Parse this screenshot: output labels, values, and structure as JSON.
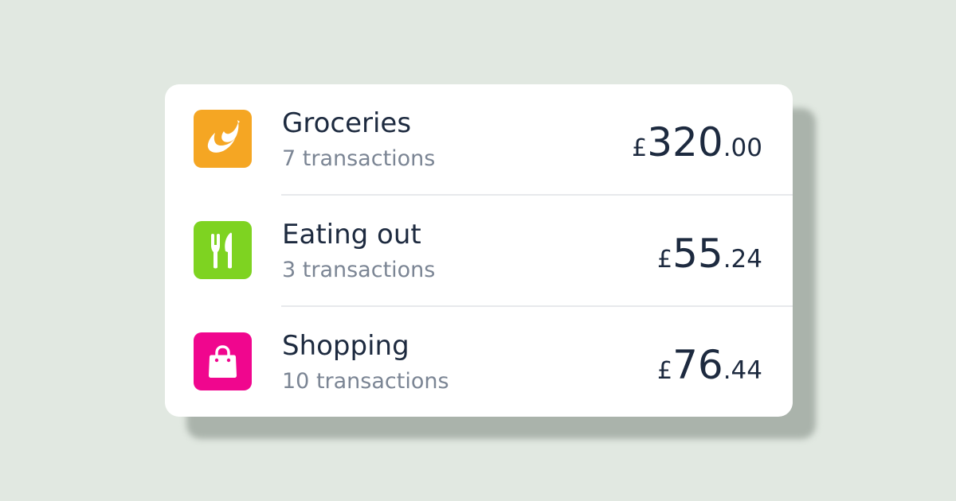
{
  "categories": [
    {
      "name": "Groceries",
      "transactions": "7 transactions",
      "currency": "£",
      "amount_major": "320",
      "amount_minor": ".00",
      "icon": "banana-icon",
      "color": "#f5a623"
    },
    {
      "name": "Eating out",
      "transactions": "3 transactions",
      "currency": "£",
      "amount_major": "55",
      "amount_minor": ".24",
      "icon": "fork-knife-icon",
      "color": "#7ed321"
    },
    {
      "name": "Shopping",
      "transactions": "10 transactions",
      "currency": "£",
      "amount_major": "76",
      "amount_minor": ".44",
      "icon": "shopping-bag-icon",
      "color": "#f0068e"
    }
  ]
}
